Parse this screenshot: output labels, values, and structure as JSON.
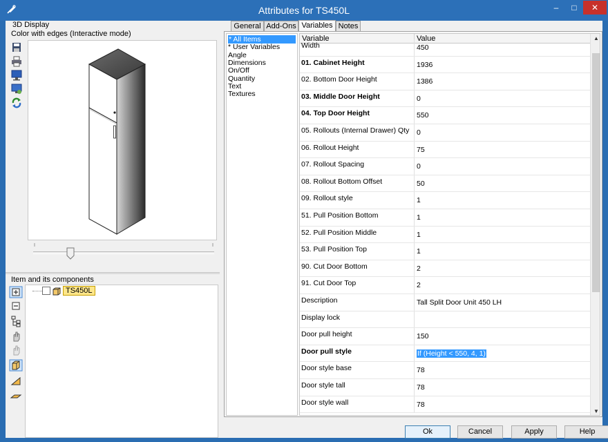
{
  "window": {
    "title": "Attributes for TS450L",
    "min_glyph": "‒",
    "max_glyph": "□",
    "close_glyph": "✕"
  },
  "display": {
    "caption": "3D Display",
    "mode": "Color with edges (Interactive mode)",
    "toolbar_icons": [
      "save-icon",
      "print-icon",
      "monitor-icon",
      "display-settings-icon",
      "refresh-icon"
    ]
  },
  "components": {
    "caption": "Item and its components",
    "node_label": "TS450L",
    "toolbar_icons": [
      "expand-icon",
      "collapse-icon",
      "tree-structure-icon",
      "hand-icon",
      "hand-disabled-icon",
      "cabinet-icon",
      "angle-icon",
      "panel-icon"
    ]
  },
  "tabs": [
    {
      "label": "General",
      "active": false
    },
    {
      "label": "Add-Ons",
      "active": false
    },
    {
      "label": "Variables",
      "active": true
    },
    {
      "label": "Notes",
      "active": false
    }
  ],
  "categories": [
    {
      "label": "* All Items",
      "selected": true
    },
    {
      "label": "* User Variables",
      "selected": false
    },
    {
      "label": "Angle",
      "selected": false
    },
    {
      "label": "Dimensions",
      "selected": false
    },
    {
      "label": "On/Off",
      "selected": false
    },
    {
      "label": "Quantity",
      "selected": false
    },
    {
      "label": "Text",
      "selected": false
    },
    {
      "label": "Textures",
      "selected": false
    }
  ],
  "grid": {
    "col_variable": "Variable",
    "col_value": "Value",
    "rows": [
      {
        "variable": "Width",
        "value": "450",
        "bold": false
      },
      {
        "variable": "01. Cabinet Height",
        "value": "1936",
        "bold": true
      },
      {
        "variable": "02. Bottom Door Height",
        "value": "1386",
        "bold": false
      },
      {
        "variable": "03. Middle Door Height",
        "value": "0",
        "bold": true
      },
      {
        "variable": "04. Top Door Height",
        "value": "550",
        "bold": true
      },
      {
        "variable": "05. Rollouts (Internal Drawer) Qty",
        "value": "0",
        "bold": false
      },
      {
        "variable": "06. Rollout Height",
        "value": "75",
        "bold": false
      },
      {
        "variable": "07. Rollout Spacing",
        "value": "0",
        "bold": false
      },
      {
        "variable": "08. Rollout Bottom Offset",
        "value": "50",
        "bold": false
      },
      {
        "variable": "09. Rollout style",
        "value": "1",
        "bold": false
      },
      {
        "variable": "51. Pull Position Bottom",
        "value": "1",
        "bold": false
      },
      {
        "variable": "52. Pull Position Middle",
        "value": "1",
        "bold": false
      },
      {
        "variable": "53. Pull Position Top",
        "value": "1",
        "bold": false
      },
      {
        "variable": "90. Cut Door Bottom",
        "value": "2",
        "bold": false
      },
      {
        "variable": "91. Cut Door Top",
        "value": "2",
        "bold": false
      },
      {
        "variable": "Description",
        "value": "Tall Split Door Unit 450 LH",
        "bold": false
      },
      {
        "variable": "Display lock",
        "value": "",
        "bold": false
      },
      {
        "variable": "Door pull height",
        "value": "150",
        "bold": false
      },
      {
        "variable": "Door pull style",
        "value": "If (Height < 550, 4, 1)",
        "bold": true,
        "highlight": true
      },
      {
        "variable": "Door style base",
        "value": "78",
        "bold": false
      },
      {
        "variable": "Door style tall",
        "value": "78",
        "bold": false
      },
      {
        "variable": "Door style wall",
        "value": "78",
        "bold": false
      }
    ]
  },
  "scroll": {
    "up_glyph": "▲",
    "down_glyph": "▼"
  },
  "buttons": {
    "ok": "Ok",
    "cancel": "Cancel",
    "apply": "Apply",
    "help": "Help"
  },
  "colors": {
    "title_bar": "#2c70b8",
    "selection": "#3399ff",
    "close_button": "#c7312b"
  }
}
